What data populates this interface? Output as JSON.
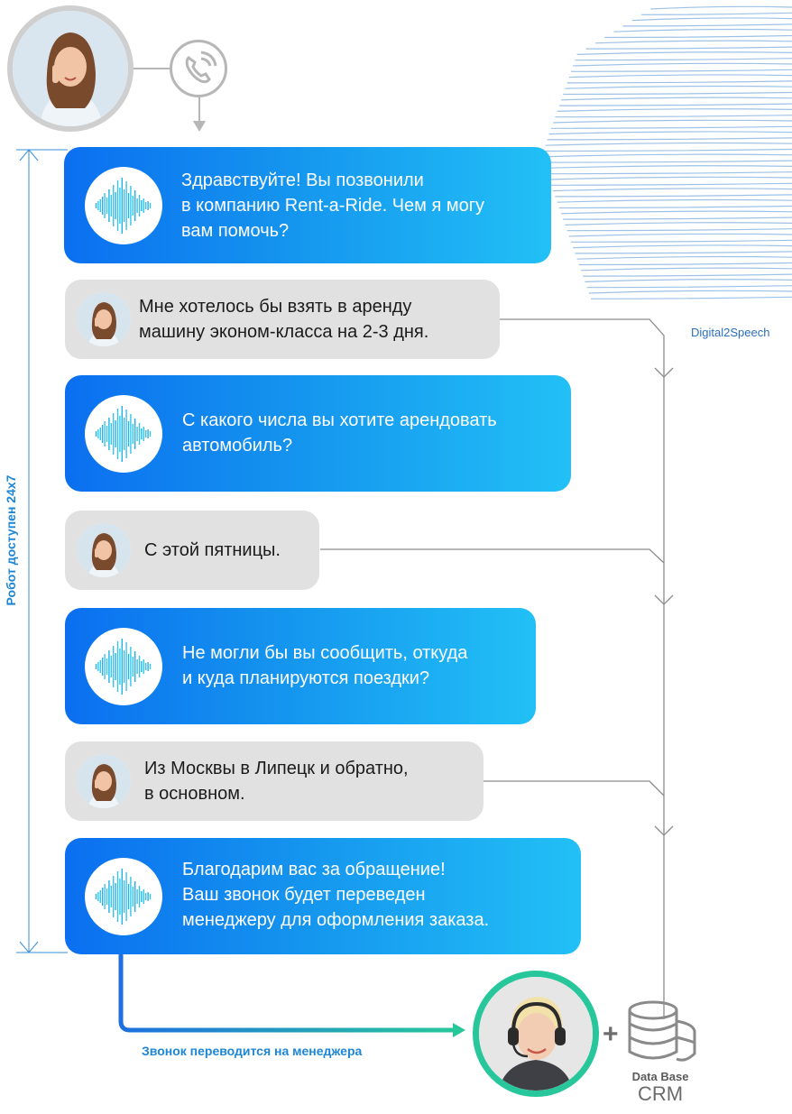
{
  "colors": {
    "accent": "#1d86d6",
    "bot_start": "#0b6ff0",
    "bot_end": "#22c0f6",
    "user_bg": "#e1e1e1",
    "manager_ring": "#27c79b"
  },
  "availability_label": "Робот доступен 24x7",
  "brand": "Digital2Speech",
  "transfer_label": "Звонок переводится на менеджера",
  "database": {
    "line1": "Data Base",
    "line2": "CRM"
  },
  "messages": [
    {
      "speaker": "bot",
      "lines": [
        "Здравствуйте! Вы позвонили",
        "в компанию Rent-a-Ride. Чем я могу",
        "вам помочь?"
      ]
    },
    {
      "speaker": "user",
      "lines": [
        "Мне хотелось бы взять в аренду",
        "машину эконом-класса на 2-3 дня."
      ]
    },
    {
      "speaker": "bot",
      "lines": [
        "С какого числа вы хотите арендовать",
        "автомобиль?"
      ]
    },
    {
      "speaker": "user",
      "lines": [
        "С этой пятницы."
      ]
    },
    {
      "speaker": "bot",
      "lines": [
        "Не могли бы вы сообщить, откуда",
        "и куда планируются поездки?"
      ]
    },
    {
      "speaker": "user",
      "lines": [
        "Из Москвы в Липецк и обратно,",
        "в основном."
      ]
    },
    {
      "speaker": "bot",
      "lines": [
        "Благодарим вас за обращение!",
        "Ваш звонок будет переведен",
        "менеджеру для оформления заказа."
      ]
    }
  ],
  "icons": {
    "phone": "phone-icon",
    "waveform": "sound-wave-icon",
    "database": "database-icon",
    "plus": "plus-icon",
    "headset": "headset-icon"
  }
}
